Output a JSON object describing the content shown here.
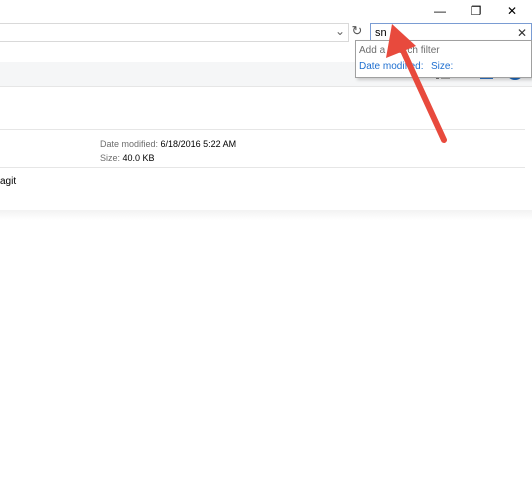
{
  "window": {
    "minimize_glyph": "—",
    "restore_glyph": "❐",
    "close_glyph": "✕"
  },
  "address": {
    "chevron_glyph": "⌄",
    "refresh_glyph": "↻"
  },
  "search": {
    "value": "sn",
    "clear_glyph": "✕"
  },
  "search_dropdown": {
    "hint": "Add a search filter",
    "filters": [
      "Date modified:",
      "Size:"
    ]
  },
  "file_details": {
    "date_label": "Date modified:",
    "date_value": "6/18/2016 5:22 AM",
    "size_label": "Size:",
    "size_value": "40.0 KB"
  },
  "second_item": {
    "name_fragment": "agit"
  },
  "toolbar": {
    "info_glyph": "i"
  },
  "colors": {
    "accent": "#1e6fd0",
    "arrow": "#e84a3d",
    "info": "#1b65b9"
  }
}
